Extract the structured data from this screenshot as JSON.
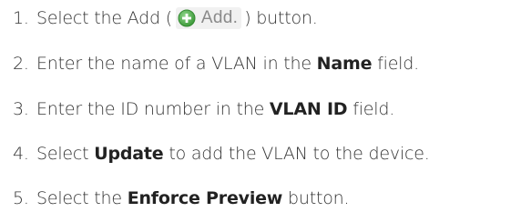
{
  "steps": [
    {
      "number": "1.",
      "before": "Select the Add (",
      "button_label": "Add.",
      "button_icon": "add-circle-icon",
      "after": ") button."
    },
    {
      "number": "2.",
      "before": "Enter the name of a VLAN in the ",
      "bold": "Name",
      "after": " field."
    },
    {
      "number": "3.",
      "before": "Enter the ID number in the ",
      "bold": "VLAN ID",
      "after": " field."
    },
    {
      "number": "4.",
      "before": "Select ",
      "bold": "Update",
      "after": " to add the VLAN to the device."
    },
    {
      "number": "5.",
      "before": "Select the ",
      "bold": "Enforce Preview",
      "after": " button."
    }
  ],
  "colors": {
    "text": "#333333",
    "icon_green": "#4caf50",
    "button_label": "#8a8a8a"
  }
}
